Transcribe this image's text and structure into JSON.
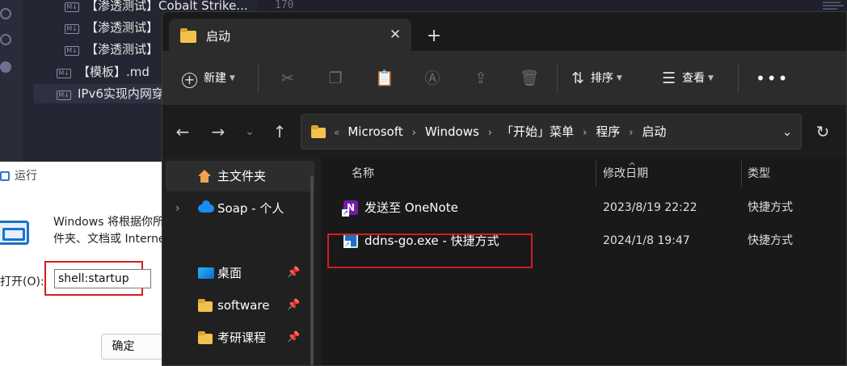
{
  "editor": {
    "files": [
      {
        "badge": "M↓",
        "label": "【渗透测试】Cobalt Strike..."
      },
      {
        "badge": "M↓",
        "label": "【渗透测试】"
      },
      {
        "badge": "M↓",
        "label": "【渗透测试】"
      },
      {
        "badge": "M↓",
        "label": "【模板】.md"
      },
      {
        "badge": "M↓",
        "label": "IPv6实现内网穿"
      }
    ],
    "line_number": "170"
  },
  "run_dialog": {
    "title": "运行",
    "description_line1": "Windows 将根据你所",
    "description_line2": "件夹、文档或 Interne",
    "open_label": "打开(O):",
    "input_value": "shell:startup",
    "ok_button": "确定"
  },
  "explorer": {
    "tab_title": "启动",
    "toolbar": {
      "new_label": "新建",
      "sort_label": "排序",
      "view_label": "查看",
      "icons": [
        "cut-icon",
        "copy-icon",
        "paste-icon",
        "rename-icon",
        "share-icon",
        "delete-icon"
      ]
    },
    "breadcrumb": [
      "Microsoft",
      "Windows",
      "「开始」菜单",
      "程序",
      "启动"
    ],
    "nav_pane": [
      {
        "label": "主文件夹",
        "icon": "home-icon"
      },
      {
        "label": "Soap - 个人",
        "icon": "onedrive-cloud-icon"
      },
      {
        "label": "桌面",
        "icon": "desktop-icon"
      },
      {
        "label": "software",
        "icon": "folder-icon"
      },
      {
        "label": "考研课程",
        "icon": "folder-icon"
      }
    ],
    "columns": {
      "name": "名称",
      "modified": "修改日期",
      "type": "类型"
    },
    "files": [
      {
        "name": "发送至 OneNote",
        "modified": "2023/8/19 22:22",
        "type": "快捷方式"
      },
      {
        "name": "ddns-go.exe - 快捷方式",
        "modified": "2024/1/8 19:47",
        "type": "快捷方式"
      }
    ]
  },
  "colors": {
    "highlight": "#d51d1d",
    "folder": "#f2c24c",
    "accent": "#1a8df0"
  }
}
